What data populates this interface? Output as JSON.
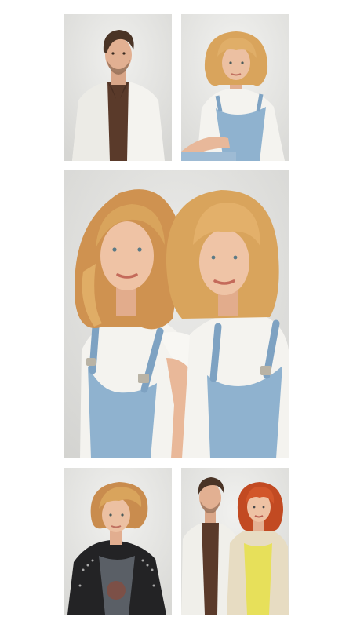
{
  "gallery": {
    "photos": [
      {
        "name": "man-white-jacket-brown-shirt",
        "backdrop": "#e4e4e2"
      },
      {
        "name": "woman-blonde-bob-overalls",
        "backdrop": "#e9e9e7"
      },
      {
        "name": "two-women-blonde-denim-overalls",
        "backdrop": "#dfdfdc"
      },
      {
        "name": "woman-short-hair-studded-leather-jacket",
        "backdrop": "#e8e8e6"
      },
      {
        "name": "couple-man-and-redhead-woman",
        "backdrop": "#e6e6e4"
      }
    ],
    "colors": {
      "page_background": "#ffffff",
      "skin": "#e8b89a",
      "blonde_hair": "#d9a45c",
      "dark_hair": "#4a3426",
      "red_hair": "#c24a22",
      "denim": "#8fb2cf",
      "white_cloth": "#f4f3ef",
      "brown_shirt": "#5a3a2a",
      "black_leather": "#232325",
      "yellow_top": "#e7e05a",
      "beige_jacket": "#e7dcc2"
    }
  }
}
